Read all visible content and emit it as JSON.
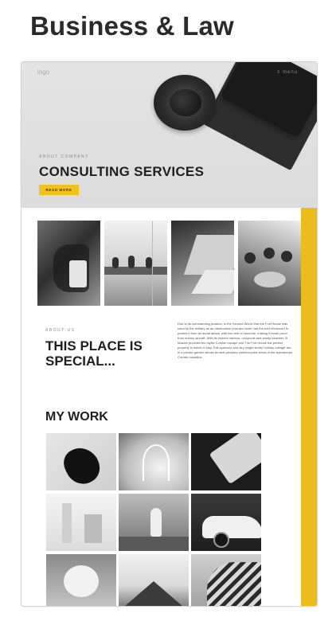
{
  "page": {
    "heading": "Business & Law"
  },
  "template": {
    "logo": "logo",
    "menu": "≡ menu",
    "hero": {
      "kicker": "ABOUT COMPANY",
      "title": "CONSULTING SERVICES",
      "button": "READ MORE"
    },
    "about": {
      "kicker": "ABOUT US",
      "title": "THIS PLACE IS SPECIAL...",
      "body": "Due to its commanding position, in the Second World War the Fort House was used by the military as an observation post and even had the roof reinforced to protect it from an aerial attack, with two feet of concrete, making it bomb proof from enemy aircraft. With its historic harbour, rockpools and sandy beaches St Mawes provides the idyllic Cornish escape and The Fort House the perfect property in which to stay.This spacious and airy single storey holiday cottage sits in a private garden whose terrace provides uninterrupted views of the spectacular Cornish coastline."
    },
    "work": {
      "title": "MY WORK"
    }
  },
  "colors": {
    "accent": "#EBBD1C",
    "button": "#F2C21B"
  }
}
